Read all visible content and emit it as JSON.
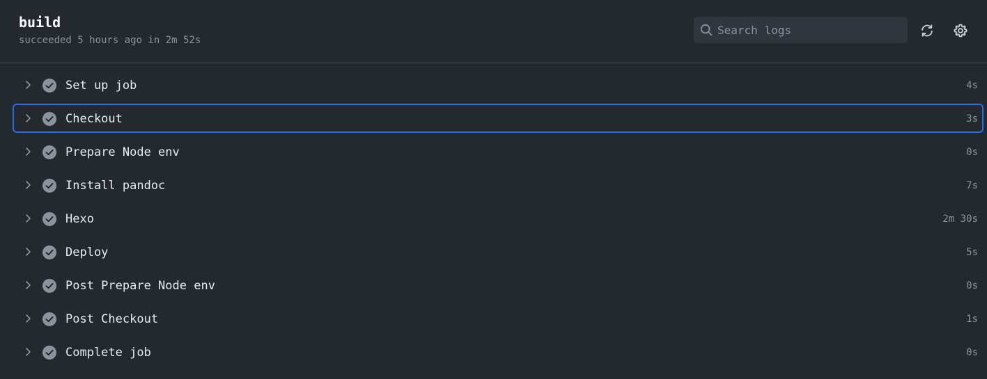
{
  "job": {
    "title": "build",
    "subtitle": "succeeded 5 hours ago in 2m 52s"
  },
  "search": {
    "placeholder": "Search logs",
    "value": "",
    "icon": "search-icon"
  },
  "toolbar": {
    "refresh_icon": "refresh-icon",
    "settings_icon": "gear-icon"
  },
  "colors": {
    "background": "#24292f",
    "focus_border": "#1f6feb",
    "check_fill": "#8b949e",
    "muted_text": "#8b949e"
  },
  "steps": [
    {
      "name": "Set up job",
      "duration": "4s",
      "status": "success"
    },
    {
      "name": "Checkout",
      "duration": "3s",
      "status": "success",
      "focused": true
    },
    {
      "name": "Prepare Node env",
      "duration": "0s",
      "status": "success"
    },
    {
      "name": "Install pandoc",
      "duration": "7s",
      "status": "success"
    },
    {
      "name": "Hexo",
      "duration": "2m 30s",
      "status": "success"
    },
    {
      "name": "Deploy",
      "duration": "5s",
      "status": "success"
    },
    {
      "name": "Post Prepare Node env",
      "duration": "0s",
      "status": "success"
    },
    {
      "name": "Post Checkout",
      "duration": "1s",
      "status": "success"
    },
    {
      "name": "Complete job",
      "duration": "0s",
      "status": "success"
    }
  ]
}
